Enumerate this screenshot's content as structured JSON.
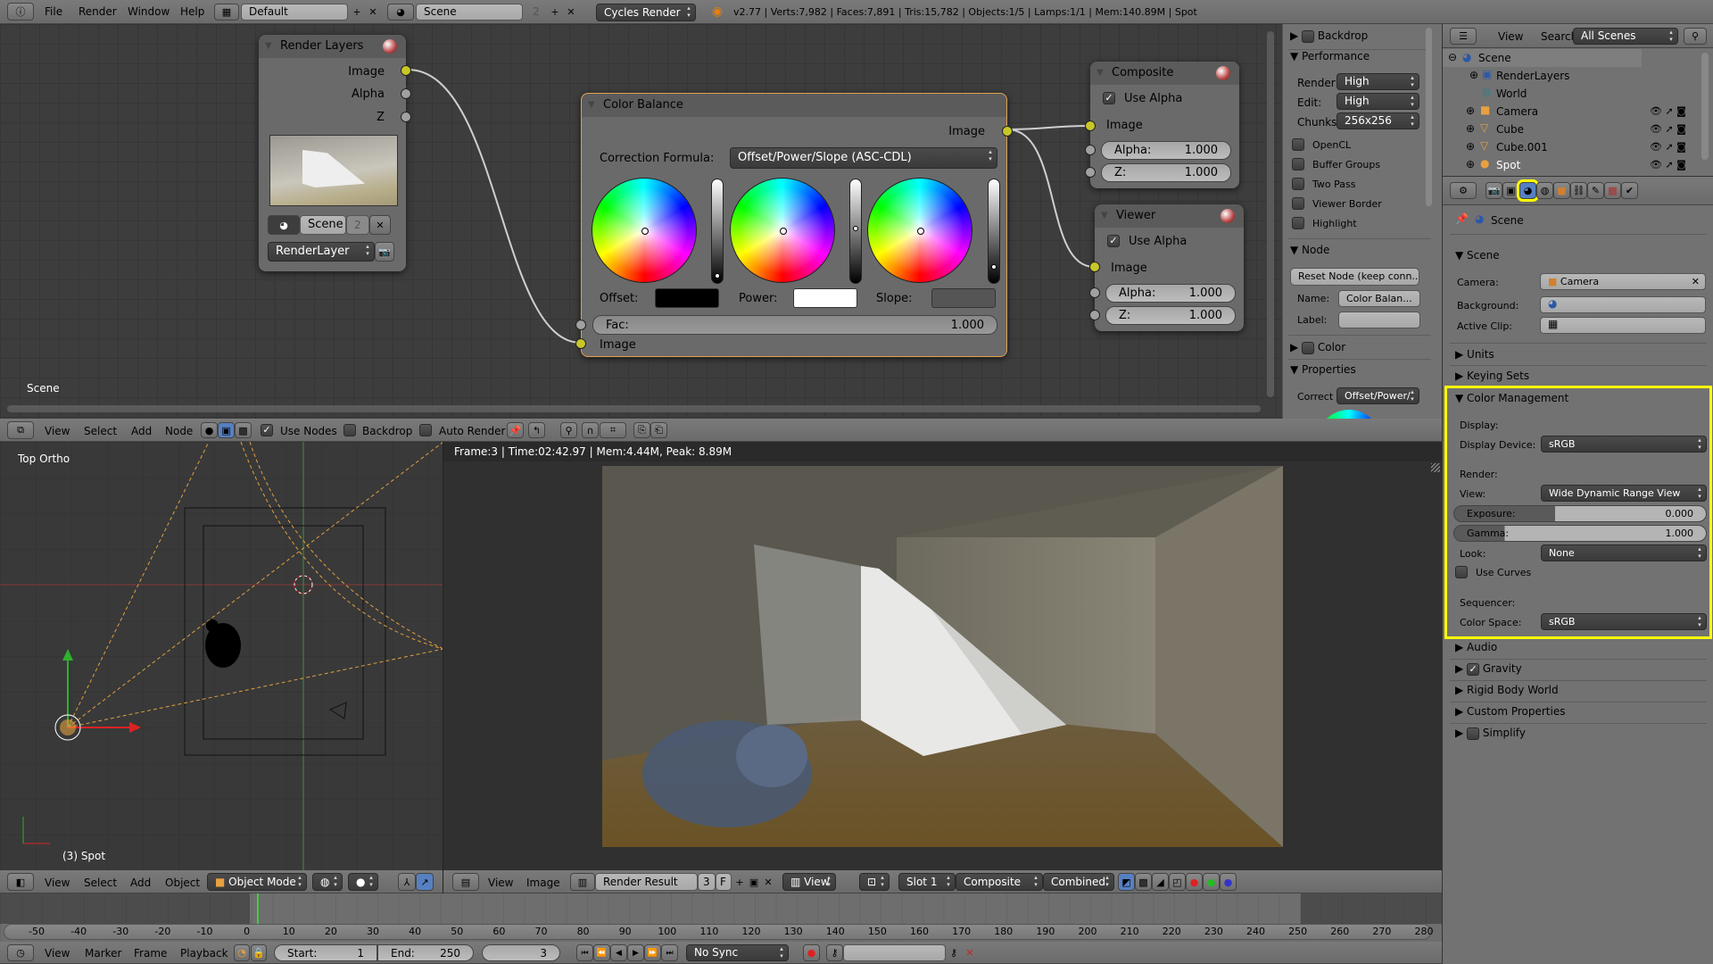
{
  "top_header": {
    "menus": [
      "File",
      "Render",
      "Window",
      "Help"
    ],
    "layout": "Default",
    "scene": "Scene",
    "scene_users": "2",
    "engine": "Cycles Render",
    "stats": "v2.77 | Verts:7,982 | Faces:7,891 | Tris:15,782 | Objects:1/5 | Lamps:1/1 | Mem:140.89M | Spot"
  },
  "node_editor": {
    "label": "Scene",
    "render_layers": {
      "title": "Render Layers",
      "outputs": [
        "Image",
        "Alpha",
        "Z"
      ],
      "scene": "Scene",
      "scene_users": "2",
      "layer": "RenderLayer"
    },
    "color_balance": {
      "title": "Color Balance",
      "output": "Image",
      "formula_label": "Correction Formula:",
      "formula": "Offset/Power/Slope (ASC-CDL)",
      "offset_label": "Offset:",
      "power_label": "Power:",
      "slope_label": "Slope:",
      "fac_label": "Fac:",
      "fac": "1.000",
      "input": "Image",
      "colors": {
        "offset": "#000000",
        "power": "#ffffff",
        "slope": "#555555"
      }
    },
    "composite": {
      "title": "Composite",
      "use_alpha": "Use Alpha",
      "input": "Image",
      "alpha_label": "Alpha:",
      "alpha": "1.000",
      "z_label": "Z:",
      "z": "1.000"
    },
    "viewer": {
      "title": "Viewer",
      "use_alpha": "Use Alpha",
      "input": "Image",
      "alpha_label": "Alpha:",
      "alpha": "1.000",
      "z_label": "Z:",
      "z": "1.000"
    },
    "header": {
      "menus": [
        "View",
        "Select",
        "Add",
        "Node"
      ],
      "use_nodes": "Use Nodes",
      "backdrop": "Backdrop",
      "auto_render": "Auto Render"
    }
  },
  "n_panel": {
    "backdrop": "Backdrop",
    "performance": "Performance",
    "render_label": "Render:",
    "render": "High",
    "edit_label": "Edit:",
    "edit": "High",
    "chunks_label": "Chunks",
    "chunks": "256x256",
    "checks": [
      "OpenCL",
      "Buffer Groups",
      "Two Pass",
      "Viewer Border",
      "Highlight"
    ],
    "node": "Node",
    "reset": "Reset Node (keep conn...",
    "name_label": "Name:",
    "name": "Color Balan...",
    "label_label": "Label:",
    "color": "Color",
    "properties": "Properties",
    "correct_label": "Correct",
    "correct": "Offset/Power/"
  },
  "outliner": {
    "menus": [
      "View",
      "Search"
    ],
    "filter": "All Scenes",
    "items": [
      "Scene",
      "RenderLayers",
      "World",
      "Camera",
      "Cube",
      "Cube.001",
      "Spot"
    ]
  },
  "properties": {
    "context": "Scene",
    "scene_panel": "Scene",
    "camera_label": "Camera:",
    "camera": "Camera",
    "background_label": "Background:",
    "clip_label": "Active Clip:",
    "units": "Units",
    "keying_sets": "Keying Sets",
    "color_management": {
      "title": "Color Management",
      "display": "Display:",
      "display_device_label": "Display Device:",
      "display_device": "sRGB",
      "render": "Render:",
      "view_label": "View:",
      "view": "Wide Dynamic Range View",
      "exposure_label": "Exposure:",
      "exposure": "0.000",
      "exposure_fill": 0.4,
      "gamma_label": "Gamma:",
      "gamma": "1.000",
      "gamma_fill": 0.2,
      "look_label": "Look:",
      "look": "None",
      "use_curves": "Use Curves",
      "sequencer": "Sequencer:",
      "color_space_label": "Color Space:",
      "color_space": "sRGB"
    },
    "audio": "Audio",
    "gravity": "Gravity",
    "rigid_body": "Rigid Body World",
    "custom_props": "Custom Properties",
    "simplify": "Simplify",
    "highlight_color": "#ffff00"
  },
  "view3d": {
    "label": "Top Ortho",
    "object": "(3) Spot",
    "header": {
      "menus": [
        "View",
        "Select",
        "Add",
        "Object"
      ],
      "mode": "Object Mode"
    }
  },
  "image_editor": {
    "info": "Frame:3 | Time:02:42.97 | Mem:4.44M, Peak: 8.89M",
    "header": {
      "menus": [
        "View",
        "Image"
      ],
      "image": "Render Result",
      "users": "3",
      "fake": "F",
      "view": "View",
      "slot": "Slot 1",
      "layer": "Composite",
      "pass": "Combined"
    }
  },
  "timeline": {
    "ticks": [
      -50,
      -40,
      -30,
      -20,
      -10,
      0,
      10,
      20,
      30,
      40,
      50,
      60,
      70,
      80,
      90,
      100,
      110,
      120,
      130,
      140,
      150,
      160,
      170,
      180,
      190,
      200,
      210,
      220,
      230,
      240,
      250,
      260,
      270,
      280
    ],
    "menus": [
      "View",
      "Marker",
      "Frame",
      "Playback"
    ],
    "start_label": "Start:",
    "start": "1",
    "end_label": "End:",
    "end": "250",
    "current": "3",
    "sync": "No Sync"
  }
}
